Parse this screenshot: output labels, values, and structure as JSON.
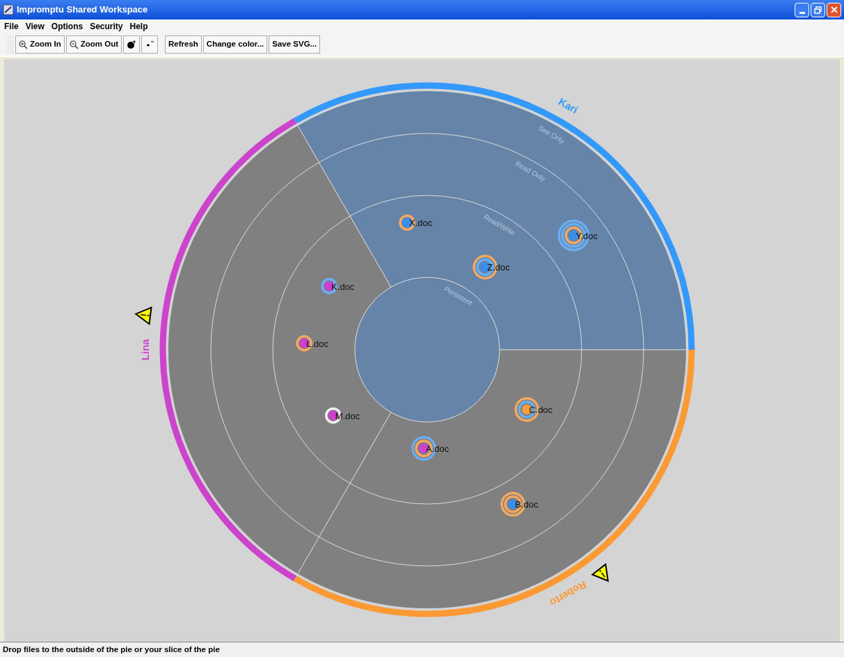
{
  "window": {
    "title": "Impromptu Shared Workspace"
  },
  "menu": [
    {
      "label": "File"
    },
    {
      "label": "View"
    },
    {
      "label": "Options"
    },
    {
      "label": "Security"
    },
    {
      "label": "Help"
    }
  ],
  "toolbar": [
    {
      "kind": "zoom-in",
      "label": "Zoom In"
    },
    {
      "kind": "zoom-out",
      "label": "Zoom Out"
    },
    {
      "kind": "grow"
    },
    {
      "kind": "shrink"
    },
    {
      "kind": "separator"
    },
    {
      "kind": "text",
      "label": "Refresh"
    },
    {
      "kind": "text",
      "label": "Change color..."
    },
    {
      "kind": "text",
      "label": "Save SVG..."
    }
  ],
  "pie": {
    "zones": [
      "See Only",
      "Read Only",
      "Read/Write",
      "Persistent"
    ],
    "owners": [
      {
        "name": "Kari",
        "color": "#3399ff",
        "selected": true,
        "warning": false
      },
      {
        "name": "Lina",
        "color": "#cc44cc",
        "selected": false,
        "warning": true
      },
      {
        "name": "Roberto",
        "color": "#ff9933",
        "selected": false,
        "warning": true
      }
    ],
    "documents": [
      {
        "name": "X.doc",
        "color": "#3a8ee8",
        "rings": [
          {
            "color": "#f5a860"
          }
        ]
      },
      {
        "name": "Y.doc",
        "color": "#3a8ee8",
        "rings": [
          {
            "color": "#f5a860"
          },
          {
            "color": "#6aaef5"
          },
          {
            "color": "#6aaef5"
          }
        ]
      },
      {
        "name": "Z.doc",
        "color": "#3a8ee8",
        "rings": [
          {
            "color": "#6aaef5"
          },
          {
            "color": "#f5a860"
          }
        ]
      },
      {
        "name": "K.doc",
        "color": "#d040d0",
        "rings": [
          {
            "color": "#6aaef5"
          }
        ]
      },
      {
        "name": "L.doc",
        "color": "#d040d0",
        "rings": [
          {
            "color": "#f5a860"
          }
        ]
      },
      {
        "name": "M.doc",
        "color": "#d040d0",
        "rings": [
          {
            "color": "#f0f0f0"
          }
        ]
      },
      {
        "name": "C.doc",
        "color": "#f5a040",
        "rings": [
          {
            "color": "#6aaef5"
          },
          {
            "color": "#f5a860"
          }
        ]
      },
      {
        "name": "A.doc",
        "color": "#d040d0",
        "rings": [
          {
            "color": "#f5a860"
          },
          {
            "color": "#6aaef5"
          }
        ]
      },
      {
        "name": "B.doc",
        "color": "#3a8ee8",
        "rings": [
          {
            "color": "#f5a860"
          },
          {
            "color": "#f5a860"
          }
        ]
      }
    ]
  },
  "status_bar": "Drop files to the outside of the pie or your slice of the pie"
}
